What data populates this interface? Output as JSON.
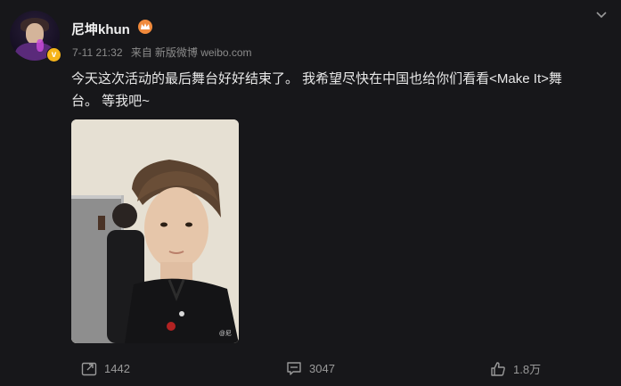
{
  "user": {
    "name": "尼坤khun",
    "verified": true
  },
  "post": {
    "date": "7-11 21:32",
    "source_prefix": "来自",
    "source": "新版微博 weibo.com",
    "text_line1": "今天这次活动的最后舞台好好结束了。 我希望尽快在中国也给你们看看<Make It>舞",
    "text_line2": "台。 等我吧~",
    "image_watermark": "@尼"
  },
  "actions": {
    "forward_count": "1442",
    "comment_count": "3047",
    "like_count": "1.8万"
  },
  "colors": {
    "background": "#17171a",
    "badge_gold": "#f6b41a",
    "crown_orange": "#f08a3c",
    "meta_gray": "#8b8b8b"
  },
  "icons": [
    "verified-badge-icon",
    "crown-icon",
    "chevron-down-icon",
    "forward-icon",
    "comment-icon",
    "thumbs-up-icon"
  ]
}
